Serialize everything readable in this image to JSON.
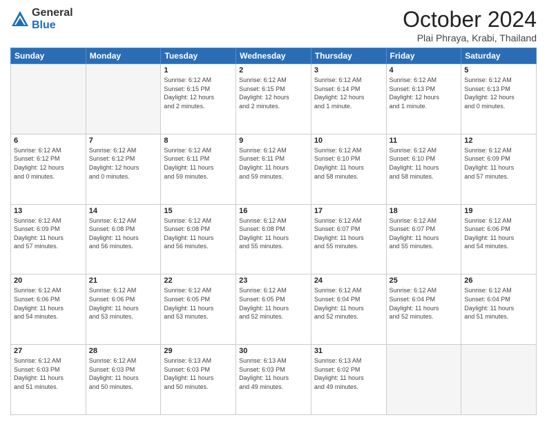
{
  "header": {
    "logo_general": "General",
    "logo_blue": "Blue",
    "month_title": "October 2024",
    "location": "Plai Phraya, Krabi, Thailand"
  },
  "days_of_week": [
    "Sunday",
    "Monday",
    "Tuesday",
    "Wednesday",
    "Thursday",
    "Friday",
    "Saturday"
  ],
  "weeks": [
    [
      {
        "day": "",
        "info": ""
      },
      {
        "day": "",
        "info": ""
      },
      {
        "day": "1",
        "info": "Sunrise: 6:12 AM\nSunset: 6:15 PM\nDaylight: 12 hours\nand 2 minutes."
      },
      {
        "day": "2",
        "info": "Sunrise: 6:12 AM\nSunset: 6:15 PM\nDaylight: 12 hours\nand 2 minutes."
      },
      {
        "day": "3",
        "info": "Sunrise: 6:12 AM\nSunset: 6:14 PM\nDaylight: 12 hours\nand 1 minute."
      },
      {
        "day": "4",
        "info": "Sunrise: 6:12 AM\nSunset: 6:13 PM\nDaylight: 12 hours\nand 1 minute."
      },
      {
        "day": "5",
        "info": "Sunrise: 6:12 AM\nSunset: 6:13 PM\nDaylight: 12 hours\nand 0 minutes."
      }
    ],
    [
      {
        "day": "6",
        "info": "Sunrise: 6:12 AM\nSunset: 6:12 PM\nDaylight: 12 hours\nand 0 minutes."
      },
      {
        "day": "7",
        "info": "Sunrise: 6:12 AM\nSunset: 6:12 PM\nDaylight: 12 hours\nand 0 minutes."
      },
      {
        "day": "8",
        "info": "Sunrise: 6:12 AM\nSunset: 6:11 PM\nDaylight: 11 hours\nand 59 minutes."
      },
      {
        "day": "9",
        "info": "Sunrise: 6:12 AM\nSunset: 6:11 PM\nDaylight: 11 hours\nand 59 minutes."
      },
      {
        "day": "10",
        "info": "Sunrise: 6:12 AM\nSunset: 6:10 PM\nDaylight: 11 hours\nand 58 minutes."
      },
      {
        "day": "11",
        "info": "Sunrise: 6:12 AM\nSunset: 6:10 PM\nDaylight: 11 hours\nand 58 minutes."
      },
      {
        "day": "12",
        "info": "Sunrise: 6:12 AM\nSunset: 6:09 PM\nDaylight: 11 hours\nand 57 minutes."
      }
    ],
    [
      {
        "day": "13",
        "info": "Sunrise: 6:12 AM\nSunset: 6:09 PM\nDaylight: 11 hours\nand 57 minutes."
      },
      {
        "day": "14",
        "info": "Sunrise: 6:12 AM\nSunset: 6:08 PM\nDaylight: 11 hours\nand 56 minutes."
      },
      {
        "day": "15",
        "info": "Sunrise: 6:12 AM\nSunset: 6:08 PM\nDaylight: 11 hours\nand 56 minutes."
      },
      {
        "day": "16",
        "info": "Sunrise: 6:12 AM\nSunset: 6:08 PM\nDaylight: 11 hours\nand 55 minutes."
      },
      {
        "day": "17",
        "info": "Sunrise: 6:12 AM\nSunset: 6:07 PM\nDaylight: 11 hours\nand 55 minutes."
      },
      {
        "day": "18",
        "info": "Sunrise: 6:12 AM\nSunset: 6:07 PM\nDaylight: 11 hours\nand 55 minutes."
      },
      {
        "day": "19",
        "info": "Sunrise: 6:12 AM\nSunset: 6:06 PM\nDaylight: 11 hours\nand 54 minutes."
      }
    ],
    [
      {
        "day": "20",
        "info": "Sunrise: 6:12 AM\nSunset: 6:06 PM\nDaylight: 11 hours\nand 54 minutes."
      },
      {
        "day": "21",
        "info": "Sunrise: 6:12 AM\nSunset: 6:06 PM\nDaylight: 11 hours\nand 53 minutes."
      },
      {
        "day": "22",
        "info": "Sunrise: 6:12 AM\nSunset: 6:05 PM\nDaylight: 11 hours\nand 53 minutes."
      },
      {
        "day": "23",
        "info": "Sunrise: 6:12 AM\nSunset: 6:05 PM\nDaylight: 11 hours\nand 52 minutes."
      },
      {
        "day": "24",
        "info": "Sunrise: 6:12 AM\nSunset: 6:04 PM\nDaylight: 11 hours\nand 52 minutes."
      },
      {
        "day": "25",
        "info": "Sunrise: 6:12 AM\nSunset: 6:04 PM\nDaylight: 11 hours\nand 52 minutes."
      },
      {
        "day": "26",
        "info": "Sunrise: 6:12 AM\nSunset: 6:04 PM\nDaylight: 11 hours\nand 51 minutes."
      }
    ],
    [
      {
        "day": "27",
        "info": "Sunrise: 6:12 AM\nSunset: 6:03 PM\nDaylight: 11 hours\nand 51 minutes."
      },
      {
        "day": "28",
        "info": "Sunrise: 6:12 AM\nSunset: 6:03 PM\nDaylight: 11 hours\nand 50 minutes."
      },
      {
        "day": "29",
        "info": "Sunrise: 6:13 AM\nSunset: 6:03 PM\nDaylight: 11 hours\nand 50 minutes."
      },
      {
        "day": "30",
        "info": "Sunrise: 6:13 AM\nSunset: 6:03 PM\nDaylight: 11 hours\nand 49 minutes."
      },
      {
        "day": "31",
        "info": "Sunrise: 6:13 AM\nSunset: 6:02 PM\nDaylight: 11 hours\nand 49 minutes."
      },
      {
        "day": "",
        "info": ""
      },
      {
        "day": "",
        "info": ""
      }
    ]
  ]
}
